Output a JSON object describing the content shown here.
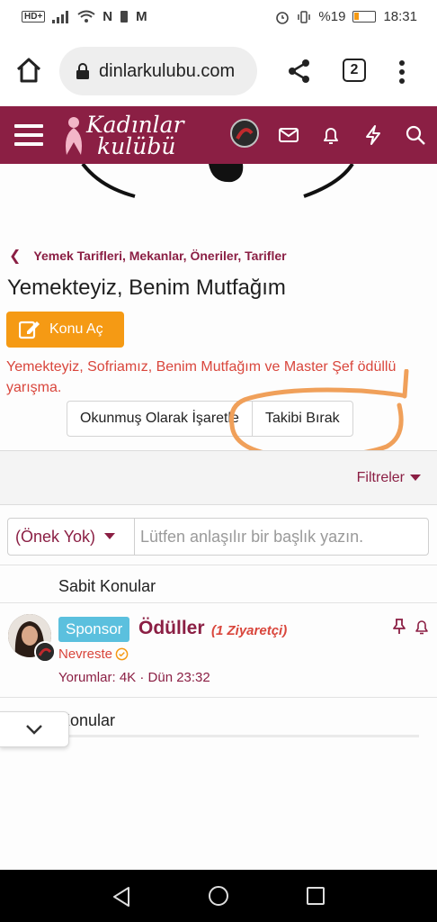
{
  "status_bar": {
    "hd_label": "HD+",
    "network_letters": "N",
    "app_letter": "M",
    "battery_percent": "%19",
    "time": "18:31"
  },
  "browser": {
    "url": "dinlarkulubu.com",
    "tab_count": "2",
    "icons": [
      "home-icon",
      "lock-icon",
      "share-icon",
      "overflow-menu-icon"
    ]
  },
  "site_header": {
    "logo_line1": "Kadınlar",
    "logo_line2": "kulübü",
    "brand_color": "#8b1f44",
    "icons": [
      "hamburger-icon",
      "avatar",
      "mail-icon",
      "bell-icon",
      "lightning-icon",
      "search-icon"
    ]
  },
  "breadcrumb": {
    "label": "Yemek Tarifleri, Mekanlar, Öneriler, Tarifler"
  },
  "forum": {
    "title": "Yemekteyiz, Benim Mutfağım",
    "new_topic_label": "Konu Aç",
    "description": "Yemekteyiz, Sofriamız, Benim Mutfağım ve Master Şef ödüllü yarışma.",
    "mark_read_label": "Okunmuş Olarak İşaretle",
    "unfollow_label": "Takibi Bırak",
    "accent_color": "#f59a14",
    "annotation_color": "#f0a05a"
  },
  "filters": {
    "label": "Filtreler"
  },
  "quick_thread": {
    "prefix_value": "(Önek Yok)",
    "title_placeholder": "Lütfen anlaşılır bir başlık yazın."
  },
  "sticky": {
    "heading": "Sabit Konular",
    "threads": [
      {
        "badge": "Sponsor",
        "title": "Ödüller",
        "visitors": "(1 Ziyaretçi)",
        "author": "Nevreste",
        "replies_label": "Yorumlar:",
        "replies": "4K",
        "separator": "·",
        "last_activity": "Dün 23:32"
      }
    ]
  },
  "topics": {
    "heading": "Konular"
  },
  "android_nav": {
    "icons": [
      "back-icon",
      "home-circle-icon",
      "recents-icon"
    ]
  }
}
